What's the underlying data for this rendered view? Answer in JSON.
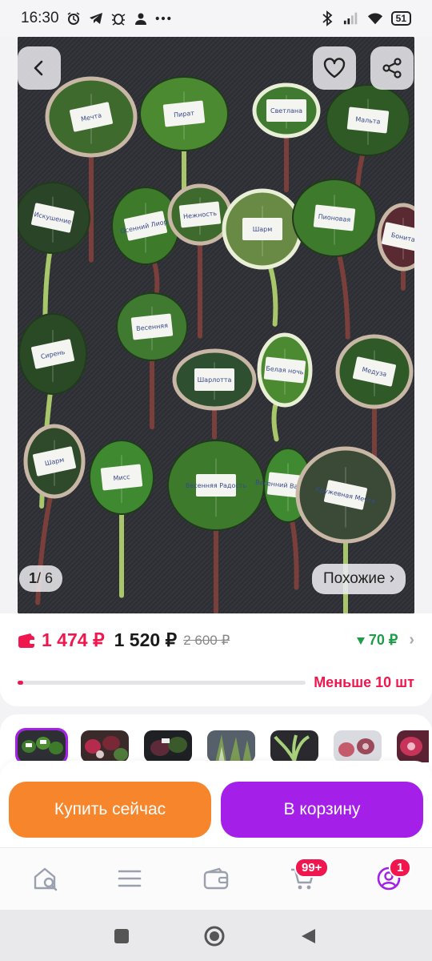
{
  "status_bar": {
    "time": "16:30",
    "battery": "51",
    "icons_left": [
      "alarm-icon",
      "telegram-icon",
      "bug-icon",
      "person-icon",
      "more-icon"
    ],
    "icons_right": [
      "bluetooth-icon",
      "signal-icon",
      "wifi-icon",
      "battery-icon"
    ]
  },
  "gallery": {
    "current": "1",
    "total": "/ 6",
    "similar_label": "Похожие ›",
    "leaf_labels": [
      "Мечта",
      "Пират",
      "Светлана",
      "Мальта",
      "Искушение",
      "Осенний Лиорс",
      "Нежность",
      "Шарм",
      "Пионовая",
      "Бонита",
      "Сирень",
      "Весенняя",
      "Шарлотта",
      "Белая ночь",
      "Медуза",
      "Шарм",
      "Мисс",
      "Весенняя Радость",
      "Весенний Вальс (Z)",
      "Кружевная Мечта"
    ]
  },
  "price": {
    "main": "1 474 ₽",
    "second": "1 520 ₽",
    "old": "2 600 ₽",
    "bonus": "70 ₽",
    "stock_text": "Меньше 10 шт",
    "stock_fraction": 0.02
  },
  "actions": {
    "buy_label": "Купить сейчас",
    "cart_label": "В корзину"
  },
  "nav": {
    "cart_badge": "99+",
    "profile_badge": "1"
  },
  "colors": {
    "accent_purple": "#a41fe8",
    "accent_orange": "#f7852c",
    "price_red": "#f0164e",
    "bonus_green": "#1e9c4a"
  }
}
